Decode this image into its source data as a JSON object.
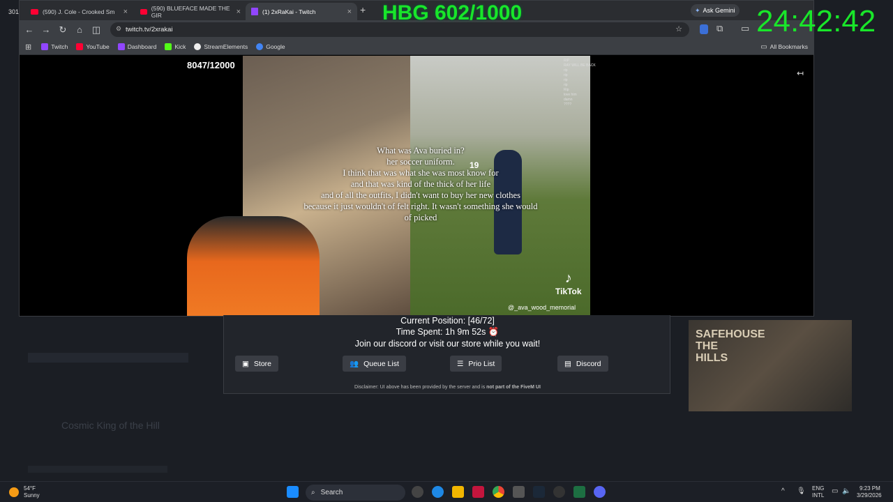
{
  "overlay": {
    "left_number": "301",
    "hbg_counter": "HBG 602/1000",
    "clock": "24:42:42",
    "hbg_color": "#19e62a"
  },
  "browser": {
    "tabs": [
      {
        "label": "(590) J. Cole - Crooked Sm",
        "icon": "youtube-icon"
      },
      {
        "label": "(590) BLUEFACE MADE THE GIR",
        "icon": "youtube-icon"
      },
      {
        "label": "(1) 2xRaKai - Twitch",
        "icon": "twitch-icon"
      }
    ],
    "new_tab": "+",
    "ask_gemini": "Ask Gemini",
    "url": "twitch.tv/2xrakai",
    "bookmarks": [
      "Twitch",
      "YouTube",
      "Dashboard",
      "Kick",
      "StreamElements",
      "Google"
    ],
    "all_bookmarks": "All Bookmarks"
  },
  "stream": {
    "counter": "8047/12000",
    "caption_lines": [
      "What was Ava buried in?",
      "her soccer uniform.",
      "I think that was what she was most know for",
      "and that was kind of the thick of her life",
      "and of all the outfits, I didn't want to buy her new clothes",
      "because it just wouldn't of felt right. It wasn't something she would",
      "of picked"
    ],
    "jersey_number": "19",
    "tiktok_label": "TikTok",
    "tiktok_handle": "@_ava_wood_memorial",
    "chat": [
      "RIP",
      "RAY WILL BE BACK",
      "rip",
      "rip",
      "rip",
      "rip",
      "Rip",
      "love him",
      "damn",
      "????"
    ]
  },
  "queue": {
    "position_label": "Current Position:",
    "position_value": "[46/72]",
    "time_label": "Time Spent:",
    "time_value": "1h 9m 52s ⏰",
    "message": "Join our discord or visit our store while you wait!",
    "buttons": [
      "Store",
      "Queue List",
      "Prio List",
      "Discord"
    ],
    "disclaimer_a": "Disclaimer: UI above has been provided by the server and is",
    "disclaimer_b": "not part of the FiveM UI"
  },
  "background": {
    "stream_title": "Cosmic King of the Hill",
    "promo_title": "SAFEHOUSE THE HILLS"
  },
  "taskbar": {
    "temperature": "54°F",
    "condition": "Sunny",
    "search_placeholder": "Search",
    "lang_a": "ENG",
    "lang_b": "INTL",
    "time": "9:23 PM",
    "date": "3/29/2026"
  }
}
